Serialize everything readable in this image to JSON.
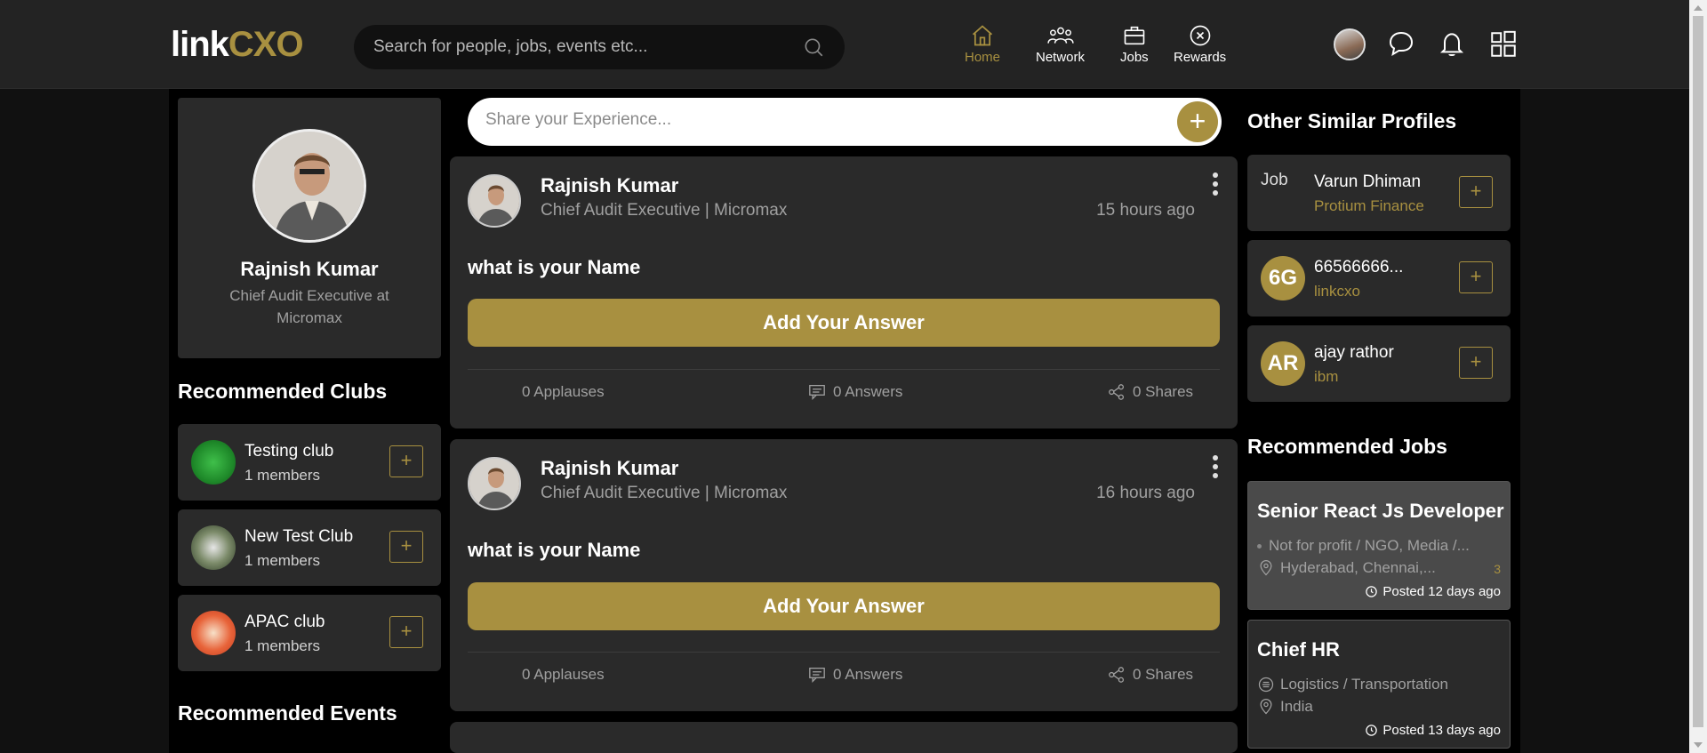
{
  "header": {
    "logo_part1": "link",
    "logo_part2": "CXO",
    "search_placeholder": "Search for people, jobs, events etc...",
    "nav": [
      {
        "label": "Home",
        "icon": "home-icon",
        "active": true
      },
      {
        "label": "Network",
        "icon": "network-icon",
        "active": false
      },
      {
        "label": "Jobs",
        "icon": "briefcase-icon",
        "active": false
      },
      {
        "label": "Rewards",
        "icon": "rewards-icon",
        "active": false
      }
    ]
  },
  "profile": {
    "name": "Rajnish Kumar",
    "title": "Chief Audit Executive at Micromax"
  },
  "clubs": {
    "heading": "Recommended Clubs",
    "items": [
      {
        "name": "Testing club",
        "members": "1 members"
      },
      {
        "name": "New Test Club",
        "members": "1 members"
      },
      {
        "name": "APAC club",
        "members": "1 members"
      }
    ]
  },
  "events": {
    "heading": "Recommended Events"
  },
  "composer": {
    "placeholder": "Share your Experience..."
  },
  "posts": [
    {
      "author": "Rajnish Kumar",
      "subtitle": "Chief Audit Executive | Micromax",
      "time": "15 hours ago",
      "question": "what is your Name",
      "answer_label": "Add Your Answer",
      "applauses": "0 Applauses",
      "answers": "0 Answers",
      "shares": "0 Shares"
    },
    {
      "author": "Rajnish Kumar",
      "subtitle": "Chief Audit Executive | Micromax",
      "time": "16 hours ago",
      "question": "what is your Name",
      "answer_label": "Add Your Answer",
      "applauses": "0 Applauses",
      "answers": "0 Answers",
      "shares": "0 Shares"
    }
  ],
  "similar": {
    "heading": "Other Similar Profiles",
    "items": [
      {
        "initials": "Job",
        "name": "Varun Dhiman",
        "org": "Protium Finance"
      },
      {
        "initials": "6G",
        "name": "66566666...",
        "org": "linkcxo"
      },
      {
        "initials": "AR",
        "name": "ajay rathor",
        "org": "ibm"
      }
    ]
  },
  "jobs": {
    "heading": "Recommended Jobs",
    "items": [
      {
        "title": "Senior React Js Developer",
        "industry": "Not for profit / NGO, Media /...",
        "location": "Hyderabad, Chennai,...",
        "extra": "3",
        "posted": "Posted 12 days ago"
      },
      {
        "title": "Chief HR",
        "industry": "Logistics / Transportation",
        "location": "India",
        "extra": "",
        "posted": "Posted 13 days ago"
      }
    ]
  },
  "colors": {
    "accent": "#a89040",
    "card": "#2a2a2a",
    "topbar": "#232323"
  }
}
